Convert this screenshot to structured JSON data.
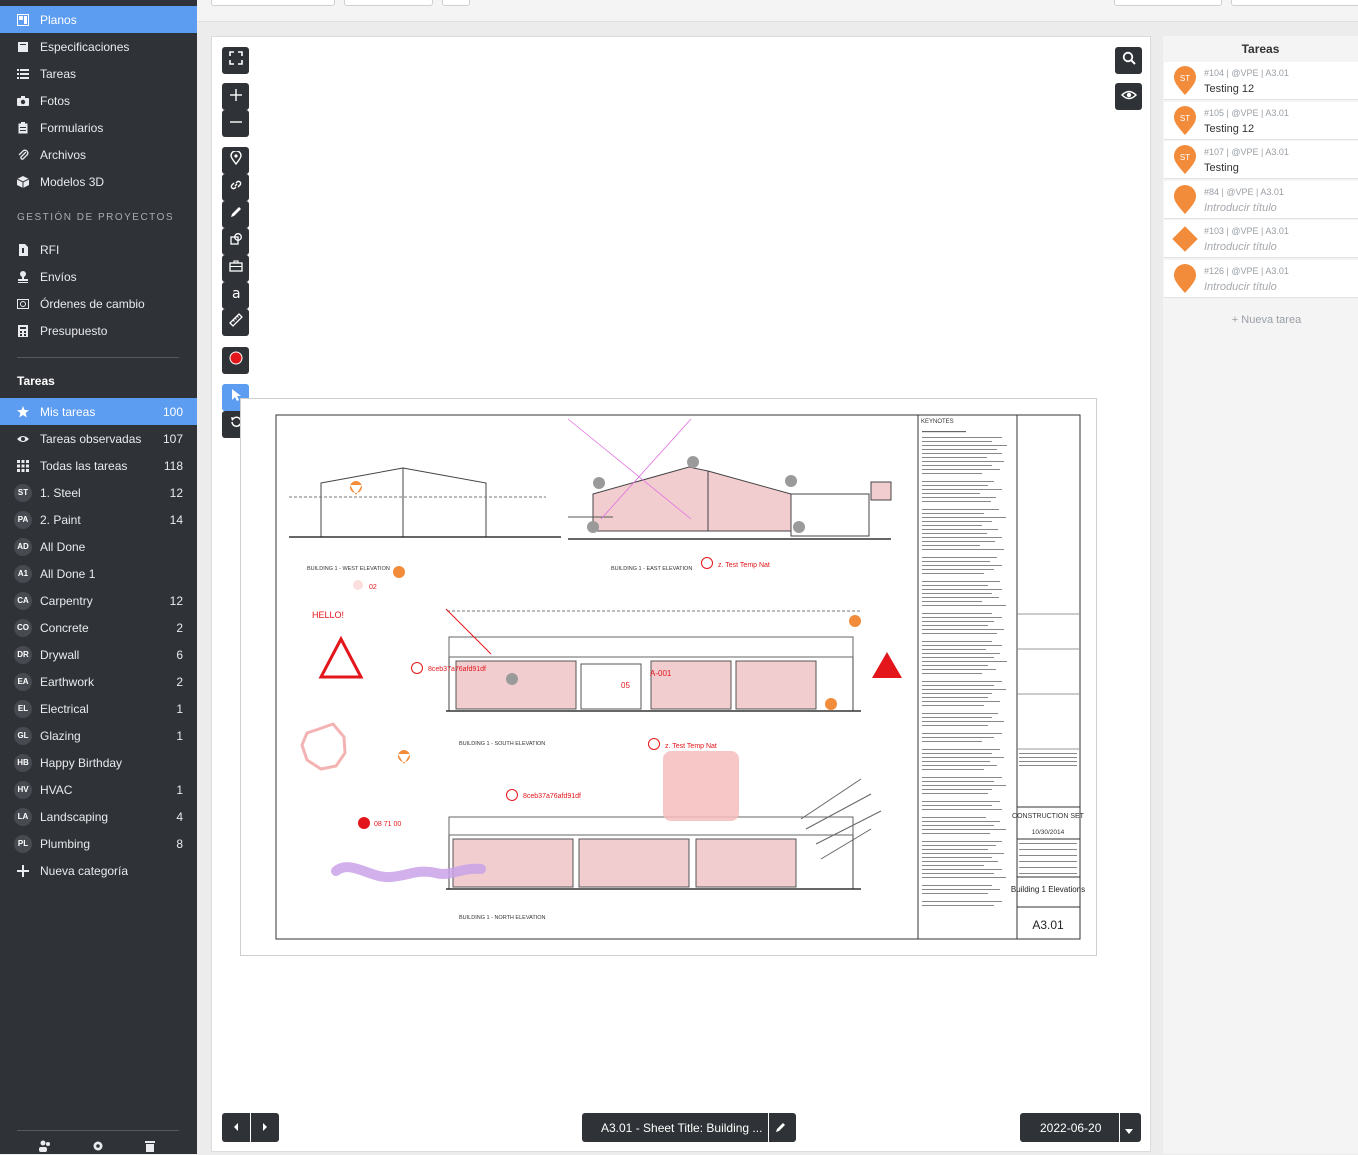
{
  "sidebar": {
    "main_items": [
      {
        "label": "Planos",
        "icon": "blueprint-icon",
        "active": true
      },
      {
        "label": "Especificaciones",
        "icon": "book-icon"
      },
      {
        "label": "Tareas",
        "icon": "list-icon"
      },
      {
        "label": "Fotos",
        "icon": "camera-icon"
      },
      {
        "label": "Formularios",
        "icon": "clipboard-icon"
      },
      {
        "label": "Archivos",
        "icon": "paperclip-icon"
      },
      {
        "label": "Modelos 3D",
        "icon": "cube-icon"
      }
    ],
    "pm_heading": "GESTIÓN DE PROYECTOS",
    "pm_items": [
      {
        "label": "RFI",
        "icon": "file-question-icon"
      },
      {
        "label": "Envíos",
        "icon": "stamp-icon"
      },
      {
        "label": "Órdenes de cambio",
        "icon": "change-order-icon"
      },
      {
        "label": "Presupuesto",
        "icon": "calculator-icon"
      }
    ],
    "tasks_heading": "Tareas",
    "task_filters": [
      {
        "label": "Mis tareas",
        "count": "100",
        "icon": "star-icon",
        "active": true
      },
      {
        "label": "Tareas observadas",
        "count": "107",
        "icon": "eye-icon"
      },
      {
        "label": "Todas las tareas",
        "count": "118",
        "icon": "grid-icon"
      }
    ],
    "categories": [
      {
        "badge": "ST",
        "label": "1. Steel",
        "count": "12"
      },
      {
        "badge": "PA",
        "label": "2. Paint",
        "count": "14"
      },
      {
        "badge": "AD",
        "label": "All Done",
        "count": ""
      },
      {
        "badge": "A1",
        "label": "All Done 1",
        "count": ""
      },
      {
        "badge": "CA",
        "label": "Carpentry",
        "count": "12"
      },
      {
        "badge": "CO",
        "label": "Concrete",
        "count": "2"
      },
      {
        "badge": "DR",
        "label": "Drywall",
        "count": "6"
      },
      {
        "badge": "EA",
        "label": "Earthwork",
        "count": "2"
      },
      {
        "badge": "EL",
        "label": "Electrical",
        "count": "1"
      },
      {
        "badge": "GL",
        "label": "Glazing",
        "count": "1"
      },
      {
        "badge": "HB",
        "label": "Happy Birthday",
        "count": ""
      },
      {
        "badge": "HV",
        "label": "HVAC",
        "count": "1"
      },
      {
        "badge": "LA",
        "label": "Landscaping",
        "count": "4"
      },
      {
        "badge": "PL",
        "label": "Plumbing",
        "count": "8"
      }
    ],
    "new_category": "Nueva categoría"
  },
  "viewer": {
    "sheet_selector": "A3.01 - Sheet Title: Building ...",
    "date": "2022-06-20",
    "sheet": {
      "annotations": {
        "hello": "HELLO!",
        "id1": "8ceb37a76afd91df",
        "id2": "8ceb37a76afd91df",
        "temp1": "z. Test Temp Nat",
        "temp2": "z. Test Temp Nat",
        "a001": "A-001",
        "n02": "02",
        "n05": "05",
        "code": "08 71 00"
      },
      "title_block": {
        "keynotes": "KEYNOTES",
        "construction": "CONSTRUCTION SET",
        "date": "10/30/2014",
        "sheet_title": "Building 1 Elevations",
        "sheet_number": "A3.01"
      },
      "elevations": {
        "west": "BUILDING 1 - WEST ELEVATION",
        "east": "BUILDING 1 - EAST ELEVATION",
        "south": "BUILDING 1 - SOUTH ELEVATION",
        "north": "BUILDING 1 - NORTH ELEVATION"
      }
    }
  },
  "tasks_panel": {
    "title": "Tareas",
    "tasks": [
      {
        "meta": "#104 | @VPE | A3.01",
        "title": "Testing 12",
        "badge": "ST",
        "shape": "pin"
      },
      {
        "meta": "#105 | @VPE | A3.01",
        "title": "Testing 12",
        "badge": "ST",
        "shape": "pin"
      },
      {
        "meta": "#107 | @VPE | A3.01",
        "title": "Testing",
        "badge": "ST",
        "shape": "pin"
      },
      {
        "meta": "#84 | @VPE | A3.01",
        "title": "Introducir título",
        "badge": "",
        "shape": "pin",
        "placeholder": true
      },
      {
        "meta": "#103 | @VPE | A3.01",
        "title": "Introducir título",
        "badge": "",
        "shape": "diamond",
        "placeholder": true
      },
      {
        "meta": "#126 | @VPE | A3.01",
        "title": "Introducir título",
        "badge": "",
        "shape": "pin",
        "placeholder": true
      }
    ],
    "new_task": "+ Nueva tarea"
  },
  "colors": {
    "sidebar_bg": "#2f3236",
    "accent": "#5c9cf1",
    "task_pin": "#f28c3b",
    "markup_red": "#e3161b"
  }
}
